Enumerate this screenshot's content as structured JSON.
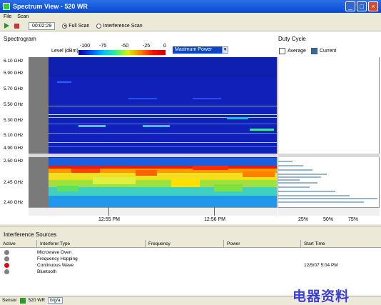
{
  "window": {
    "title": "Spectrum View - 520 WR"
  },
  "menu": {
    "file": "File",
    "scan": "Scan"
  },
  "toolbar": {
    "time": "00:02:29",
    "full_scan": "Full Scan",
    "interference_scan": "Interference Scan"
  },
  "spectrogram": {
    "title": "Spectrogram",
    "level_label": "Level (dBm)",
    "level_ticks": [
      "-100",
      "-75",
      "-50",
      "-25",
      "0"
    ],
    "mode": "Maximum Power",
    "upper_ticks": [
      "6.10 GHz",
      "5.90 GHz",
      "5.70 GHz",
      "5.50 GHz",
      "5.30 GHz",
      "5.10 GHz",
      "4.90 GHz"
    ],
    "lower_ticks": [
      "2.50 GHz",
      "2.45 GHz",
      "2.40 GHz"
    ],
    "time_ticks": [
      "12:55 PM",
      "12:56 PM"
    ]
  },
  "duty": {
    "title": "Duty Cycle",
    "average": "Average",
    "current": "Current",
    "ticks": [
      "25%",
      "50%",
      "75%"
    ],
    "current_color": "#2e6e9e"
  },
  "interference": {
    "title": "Interference Sources",
    "columns": [
      "Active",
      "Interferer Type",
      "Frequency",
      "Power",
      "Start Time"
    ],
    "rows": [
      {
        "type": "Microwave Oven",
        "start": "",
        "color": "#808080"
      },
      {
        "type": "Frequency Hopping",
        "start": "",
        "color": "#808080"
      },
      {
        "type": "Continuous Wave",
        "start": "12/5/07 5:04 PM",
        "color": "#d01010"
      },
      {
        "type": "Bluetooth",
        "start": "",
        "color": "#808080"
      }
    ]
  },
  "status": {
    "sensor": "Sensor",
    "device": "520 WR",
    "tag": "b/g/a"
  },
  "watermark": "电器资料"
}
